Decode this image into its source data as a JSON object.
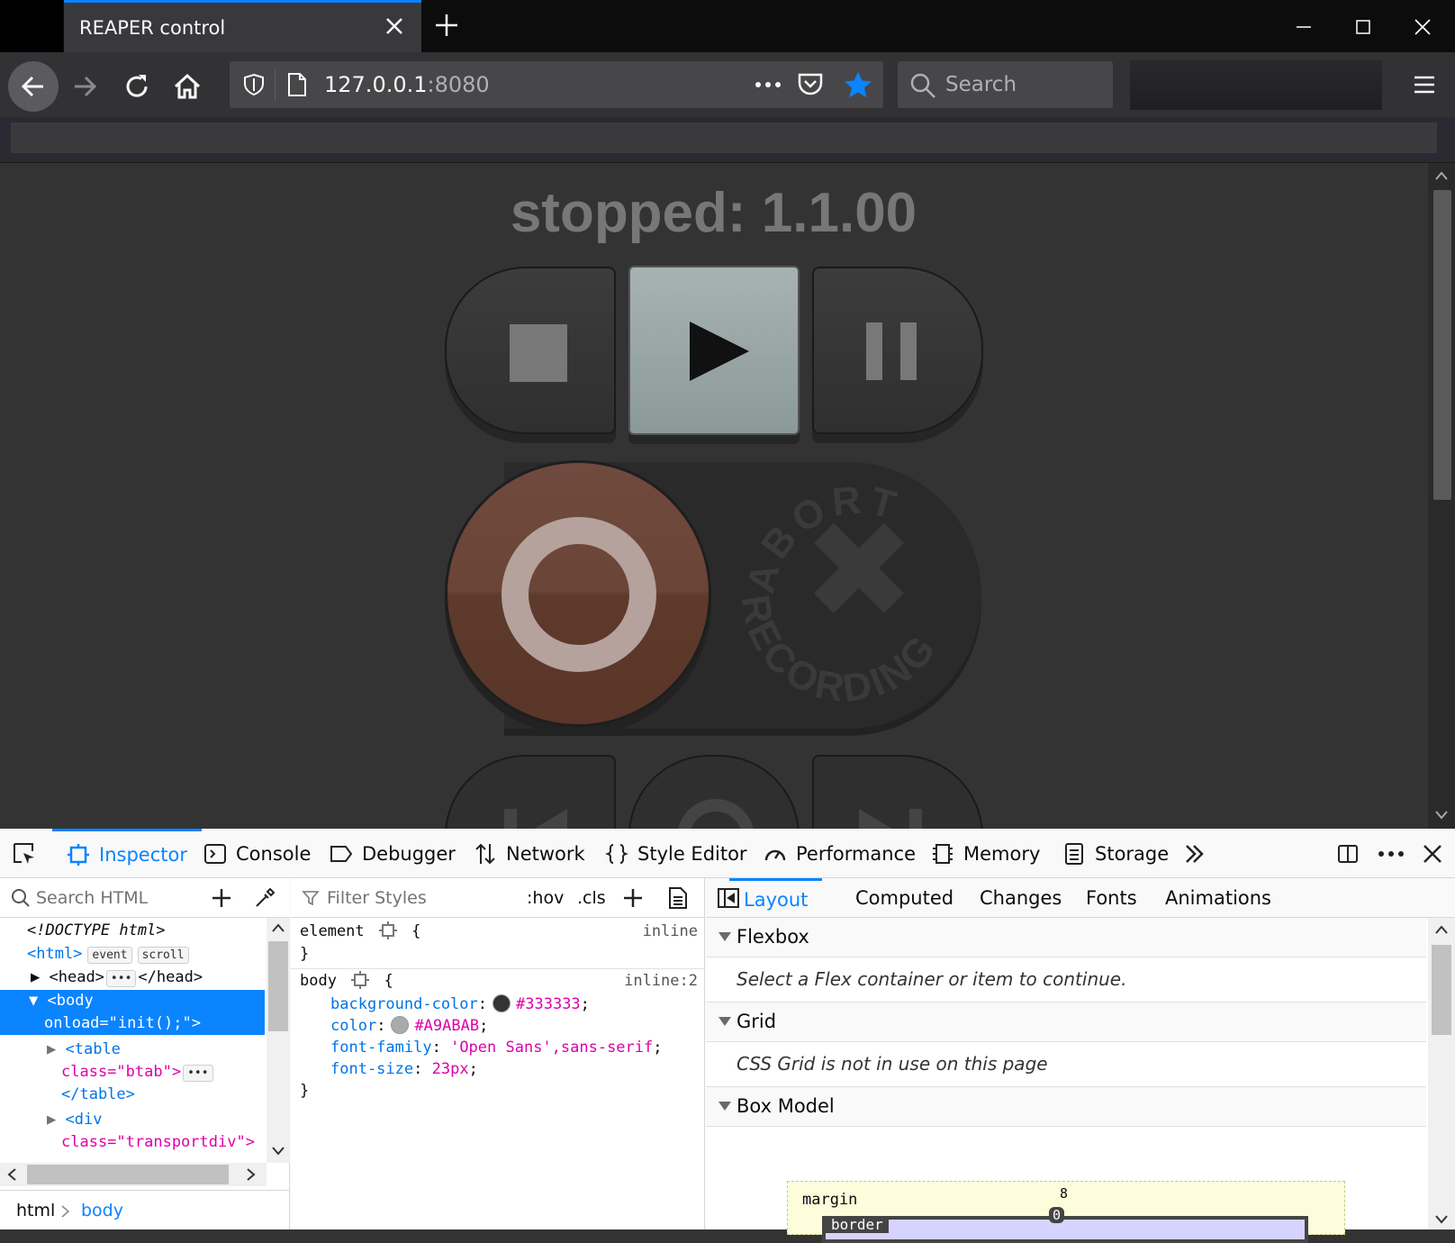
{
  "browser": {
    "tab_title": "REAPER control",
    "url_host": "127.0.0.1",
    "url_port": ":8080",
    "search_placeholder": "Search"
  },
  "page": {
    "status_text": "stopped: 1.1.00",
    "abort_label_top": "ABORT",
    "abort_label_bottom": "RECORDING"
  },
  "devtools": {
    "tabs": [
      "Inspector",
      "Console",
      "Debugger",
      "Network",
      "Style Editor",
      "Performance",
      "Memory",
      "Storage"
    ],
    "markup": {
      "search_placeholder": "Search HTML",
      "doctype": "<!DOCTYPE html>",
      "html_open": "<html>",
      "badge_event": "event",
      "badge_scroll": "scroll",
      "head_open": "<head>",
      "head_close": "</head>",
      "body_open": "<body",
      "body_attr": "onload=\"init();\">",
      "table_open": "<table",
      "table_attr": "class=\"btab\">",
      "table_close": "</table>",
      "div_open": "<div",
      "div_attr": "class=\"transportdiv\">"
    },
    "breadcrumbs": [
      "html",
      "body"
    ],
    "rules": {
      "filter_placeholder": "Filter Styles",
      "hov": ":hov",
      "cls": ".cls",
      "element_selector": "element",
      "element_source": "inline",
      "body_selector": "body",
      "body_source": "inline:2",
      "declarations": [
        {
          "prop": "background-color",
          "value": "#333333",
          "swatch": "#333333"
        },
        {
          "prop": "color",
          "value": "#A9ABAB",
          "swatch": "#A9ABAB"
        },
        {
          "prop": "font-family",
          "value": "'Open Sans',sans-serif"
        },
        {
          "prop": "font-size",
          "value": "23px"
        }
      ]
    },
    "layout": {
      "tabs": [
        "Layout",
        "Computed",
        "Changes",
        "Fonts",
        "Animations"
      ],
      "flexbox_title": "Flexbox",
      "flexbox_message": "Select a Flex container or item to continue.",
      "grid_title": "Grid",
      "grid_message": "CSS Grid is not in use on this page",
      "boxmodel_title": "Box Model",
      "margin_label": "margin",
      "margin_value": "8",
      "border_label": "border",
      "border_value": "0"
    }
  }
}
